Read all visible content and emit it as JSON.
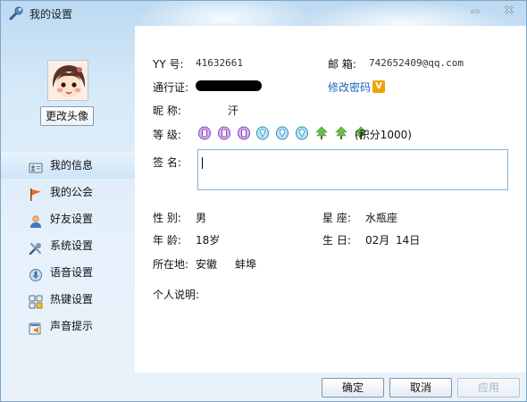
{
  "window": {
    "title": "我的设置"
  },
  "profile": {
    "change_avatar_label": "更改头像"
  },
  "sidebar": {
    "items": [
      {
        "label": "我的信息",
        "icon": "id-card-icon",
        "active": true
      },
      {
        "label": "我的公会",
        "icon": "flag-icon",
        "active": false
      },
      {
        "label": "好友设置",
        "icon": "user-icon",
        "active": false
      },
      {
        "label": "系统设置",
        "icon": "tools-icon",
        "active": false
      },
      {
        "label": "语音设置",
        "icon": "voice-icon",
        "active": false
      },
      {
        "label": "热键设置",
        "icon": "hotkey-icon",
        "active": false
      },
      {
        "label": "声音提示",
        "icon": "sound-icon",
        "active": false
      }
    ]
  },
  "info": {
    "yy_label": "YY 号:",
    "yy_value": "41632661",
    "email_label": "邮 箱:",
    "email_value": "742652409@qq.com",
    "passport_label": "通行证:",
    "change_password": "修改密码",
    "vip_badge": "V",
    "nickname_label": "昵 称:",
    "nickname_value": "汗",
    "level_label": "等 级:",
    "level_icons": [
      "purple-crown-icon",
      "purple-crown-icon",
      "purple-crown-icon",
      "blue-diamond-icon",
      "blue-diamond-icon",
      "blue-diamond-icon",
      "green-leaf-icon",
      "green-leaf-icon",
      "green-leaf-icon"
    ],
    "points_text": "(积分1000)",
    "signature_label": "签 名:",
    "signature_value": "",
    "gender_label": "性 别:",
    "gender_value": "男",
    "zodiac_label": "星 座:",
    "zodiac_value": "水瓶座",
    "age_label": "年 龄:",
    "age_value": "18岁",
    "birthday_label": "生 日:",
    "birthday_month": "02月",
    "birthday_day": "14日",
    "location_label": "所在地:",
    "location_province": "安徽",
    "location_city": "蚌埠",
    "bio_label": "个人说明:"
  },
  "buttons": {
    "ok": "确定",
    "cancel": "取消",
    "apply": "应用"
  },
  "colors": {
    "link": "#1b64b8",
    "active_nav": "#cde4f8",
    "sign_border": "#7fb4dc"
  }
}
